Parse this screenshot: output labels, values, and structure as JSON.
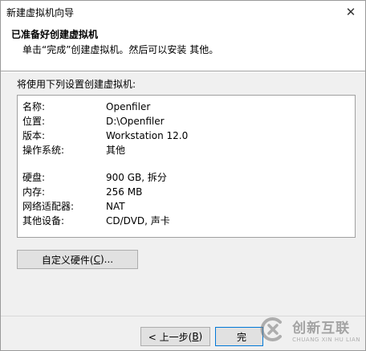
{
  "window": {
    "title": "新建虚拟机向导",
    "close_glyph": "✕"
  },
  "header": {
    "heading": "已准备好创建虚拟机",
    "subheading": "单击“完成”创建虚拟机。然后可以安装 其他。"
  },
  "intro": "将使用下列设置创建虚拟机:",
  "summary": [
    {
      "key": "名称:",
      "value": "Openfiler"
    },
    {
      "key": "位置:",
      "value": "D:\\Openfiler"
    },
    {
      "key": "版本:",
      "value": "Workstation 12.0"
    },
    {
      "key": "操作系统:",
      "value": "其他"
    },
    {
      "key": "硬盘:",
      "value": "900 GB, 拆分"
    },
    {
      "key": "内存:",
      "value": "256 MB"
    },
    {
      "key": "网络适配器:",
      "value": "NAT"
    },
    {
      "key": "其他设备:",
      "value": "CD/DVD, 声卡"
    }
  ],
  "buttons": {
    "customize_hw_pre": "自定义硬件(",
    "customize_hw_key": "C",
    "customize_hw_post": ")...",
    "back_pre": "< 上一步(",
    "back_key": "B",
    "back_post": ")",
    "finish": "完"
  },
  "watermark": {
    "cn": "创新互联",
    "en": "CHUANG XIN HU LIAN"
  }
}
